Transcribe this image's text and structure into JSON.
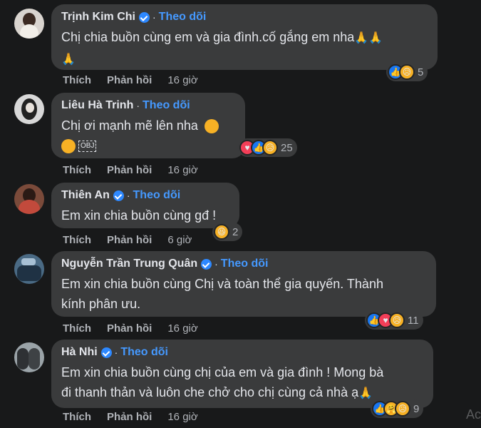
{
  "actions": {
    "like": "Thích",
    "reply": "Phản hồi"
  },
  "follow_label": "Theo dõi",
  "separator": "·",
  "comments": [
    {
      "name": "Trịnh Kim Chi",
      "verified": true,
      "text_line1": "Chị chia buồn cùng em và gia đình.cố gắng em nha",
      "text_emoji": "🙏🙏",
      "text_line2_emoji": "🙏",
      "time": "16 giờ",
      "reactions": [
        "like",
        "sad"
      ],
      "reaction_count": "5"
    },
    {
      "name": "Liêu Hà Trinh",
      "verified": false,
      "text_line1": "Chị ơi mạnh mẽ lên nha",
      "text_line2_obj": "OBJ",
      "time": "16 giờ",
      "reactions": [
        "love",
        "like",
        "sad"
      ],
      "reaction_count": "25"
    },
    {
      "name": "Thiên An",
      "verified": true,
      "text_line1": "Em xin chia buồn cùng gđ !",
      "time": "6 giờ",
      "reactions": [
        "haha"
      ],
      "reaction_count": "2"
    },
    {
      "name": "Nguyễn Trần Trung Quân",
      "verified": true,
      "text_line1": "Em xin chia buồn cùng Chị và toàn thể gia quyến. Thành",
      "text_line2": "kính phân ưu.",
      "time": "16 giờ",
      "reactions": [
        "like",
        "love",
        "sad"
      ],
      "reaction_count": "11"
    },
    {
      "name": "Hà Nhi",
      "verified": true,
      "text_line1": "Em xin chia buồn cùng chị của em và gia đình ! Mong bà",
      "text_line2": "đi thanh thản và luôn che chở cho chị cùng cả nhà ạ",
      "text_emoji": "🙏",
      "time": "16 giờ",
      "reactions": [
        "like",
        "care",
        "sad"
      ],
      "reaction_count": "9"
    }
  ],
  "watermark": "Ac",
  "colors": {
    "background": "#18191a",
    "bubble": "#3a3b3c",
    "follow": "#4599ff",
    "like": "#1877f2",
    "love": "#f33e58",
    "emoji": "#f7b125"
  }
}
